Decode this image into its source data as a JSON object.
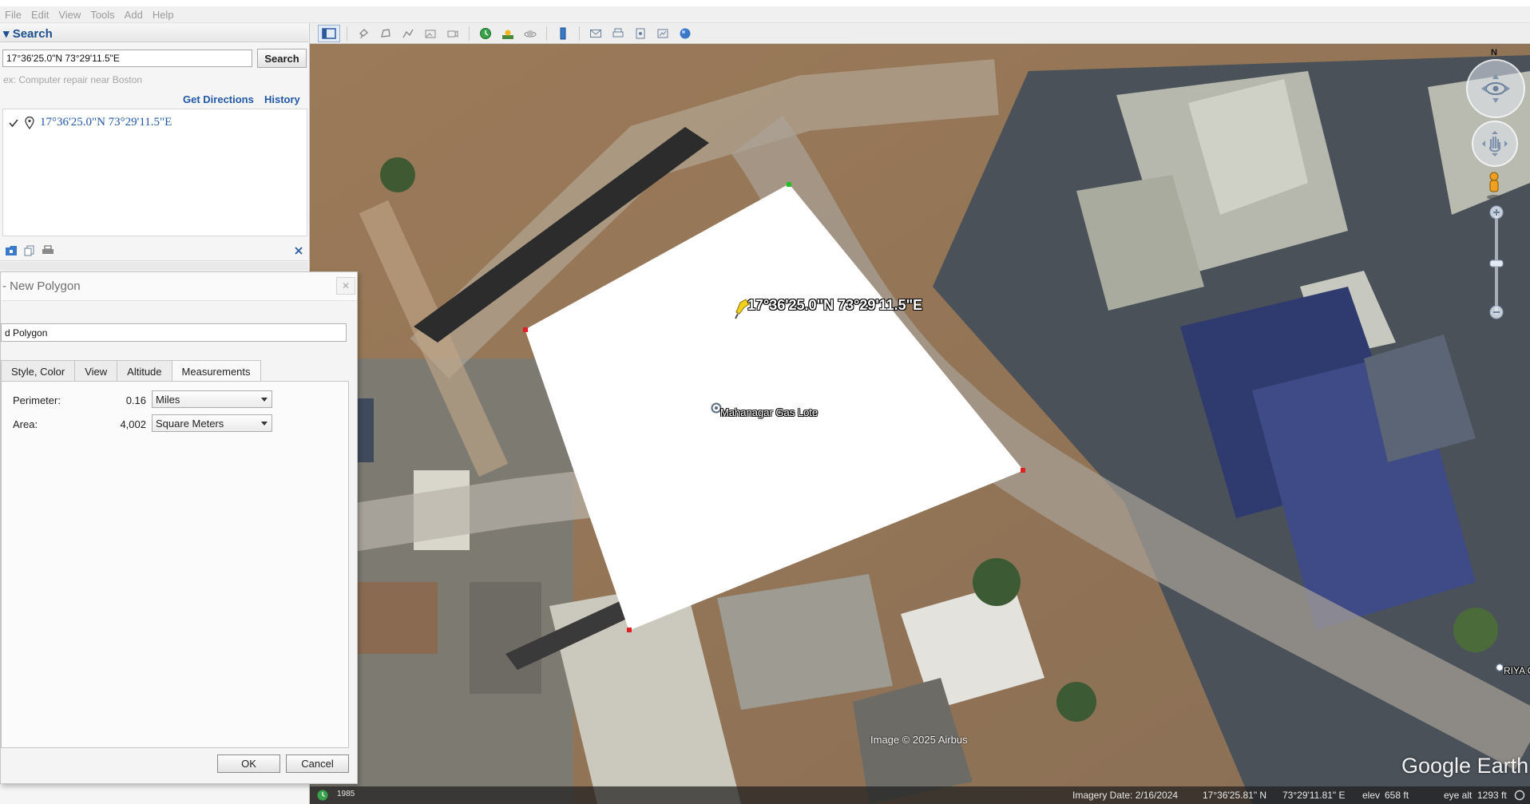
{
  "menu": [
    "File",
    "Edit",
    "View",
    "Tools",
    "Add",
    "Help"
  ],
  "search": {
    "header": "▾ Search",
    "query": "17°36'25.0\"N 73°29'11.5\"E",
    "button": "Search",
    "hint": "ex: Computer repair near Boston",
    "get_directions": "Get Directions",
    "history": "History",
    "result": "17°36'25.0\"N 73°29'11.5\"E"
  },
  "dialog": {
    "title": "- New Polygon",
    "name_value": "d Polygon",
    "tabs": [
      "Style, Color",
      "View",
      "Altitude",
      "Measurements"
    ],
    "active_tab": "Measurements",
    "perimeter_label": "Perimeter:",
    "perimeter_value": "0.16",
    "perimeter_unit": "Miles",
    "area_label": "Area:",
    "area_value": "4,002",
    "area_unit": "Square Meters",
    "ok": "OK",
    "cancel": "Cancel"
  },
  "map": {
    "placemark_label": "17°36'25.0\"N 73°29'11.5\"E",
    "poi_label": "Mahanagar Gas Lote",
    "edge_label": "RIYA C",
    "attribution": "Image © 2025 Airbus",
    "watermark": "Google Earth",
    "compass_north": "N",
    "history_year": "1985"
  },
  "status": {
    "imagery_date": "Imagery Date: 2/16/2024",
    "lat": "17°36'25.81\" N",
    "lon": "73°29'11.81\" E",
    "elev_label": "elev",
    "elev_value": "658 ft",
    "eye_alt_label": "eye alt",
    "eye_alt_value": "1293 ft"
  },
  "colors": {
    "link_blue": "#1f58a7",
    "polygon_fill": "#ffffff",
    "vertex_red": "#e02020",
    "vertex_green": "#22c022",
    "pin_yellow": "#f2d21b"
  }
}
